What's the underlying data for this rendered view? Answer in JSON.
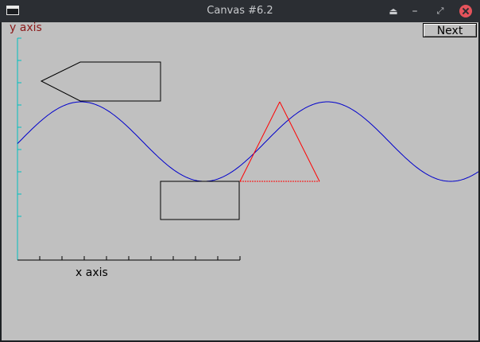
{
  "window": {
    "title": "Canvas #6.2",
    "icons": [
      "app-window-icon",
      "eject-icon",
      "minimize-icon",
      "restore-icon",
      "close-icon"
    ]
  },
  "toolbar": {
    "next_label": "Next"
  },
  "canvas": {
    "background": "#c0c0c0",
    "y_axis_label": "y axis",
    "x_axis_label": "x axis",
    "colors": {
      "y_axis": "#00c0c0",
      "x_axis": "#000000",
      "sine": "#0000cc",
      "triangle": "#ff0000",
      "shapes": "#000000",
      "y_label": "#8b1a1a"
    }
  }
}
